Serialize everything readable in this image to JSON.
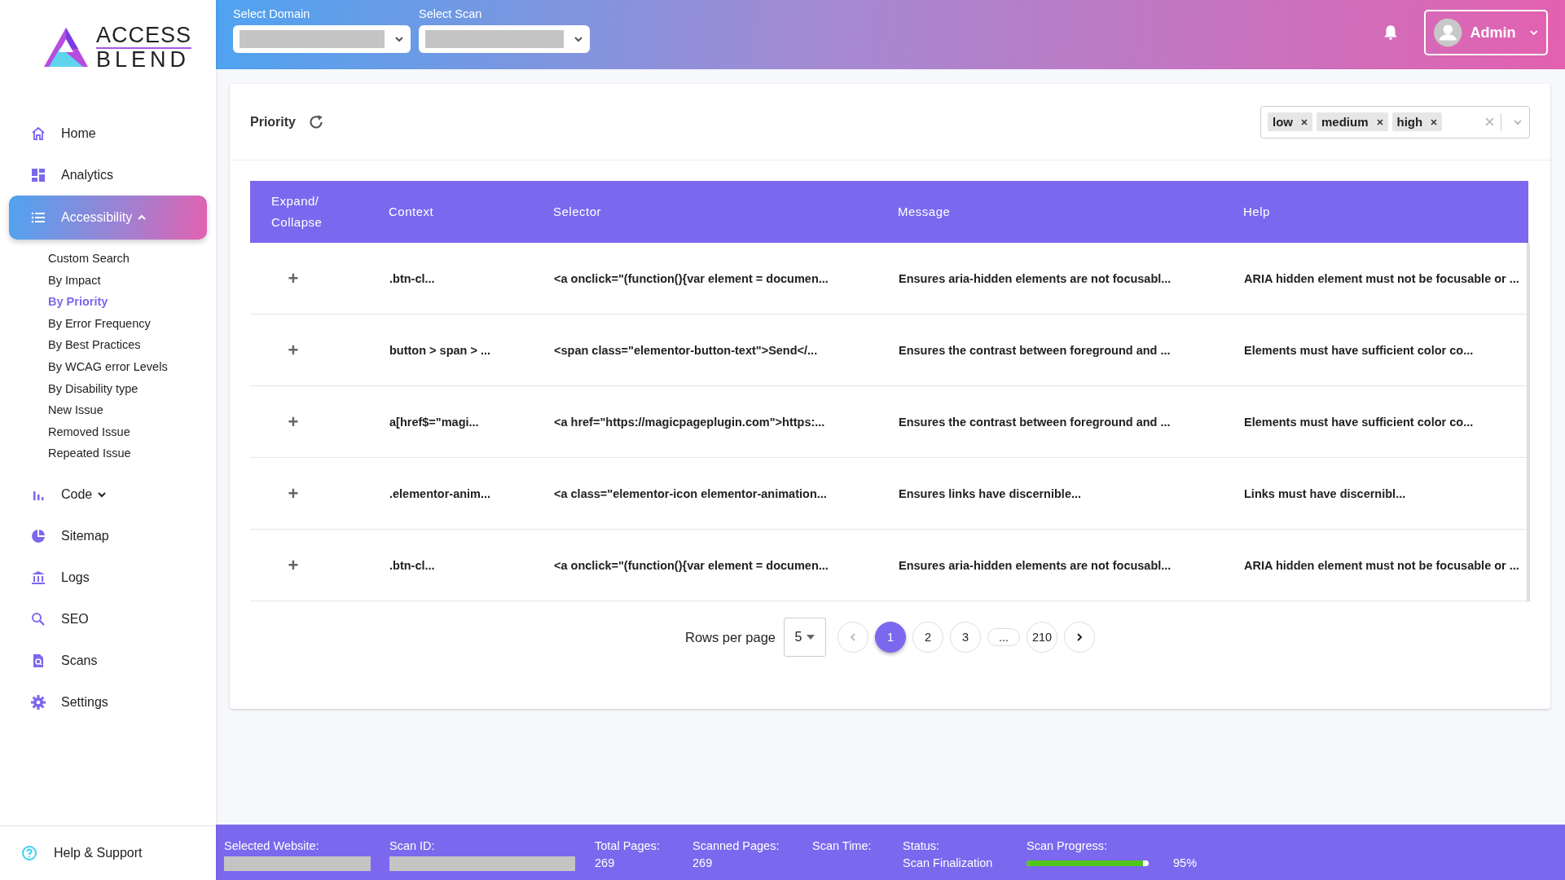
{
  "logo": {
    "line1": "ACCESS",
    "line2": "BLEND"
  },
  "nav": [
    {
      "label": "Home",
      "kind": "home",
      "selected": false
    },
    {
      "label": "Analytics",
      "kind": "dashboard",
      "selected": false
    },
    {
      "label": "Accessibility",
      "kind": "list",
      "selected": true,
      "expanded": true,
      "children": [
        {
          "label": "Custom Search",
          "selected": false
        },
        {
          "label": "By Impact",
          "selected": false
        },
        {
          "label": "By Priority",
          "selected": true
        },
        {
          "label": "By Error Frequency",
          "selected": false
        },
        {
          "label": "By Best Practices",
          "selected": false
        },
        {
          "label": "By WCAG error Levels",
          "selected": false
        },
        {
          "label": "By Disability type",
          "selected": false
        },
        {
          "label": "New Issue",
          "selected": false
        },
        {
          "label": "Removed Issue",
          "selected": false
        },
        {
          "label": "Repeated Issue",
          "selected": false
        }
      ]
    },
    {
      "label": "Code",
      "kind": "bars",
      "selected": false,
      "expanded": false
    },
    {
      "label": "Sitemap",
      "kind": "pie",
      "selected": false
    },
    {
      "label": "Logs",
      "kind": "bank",
      "selected": false
    },
    {
      "label": "SEO",
      "kind": "search",
      "selected": false
    },
    {
      "label": "Scans",
      "kind": "scan",
      "selected": false
    },
    {
      "label": "Settings",
      "kind": "gear",
      "selected": false
    }
  ],
  "help": {
    "label": "Help & Support"
  },
  "header": {
    "selects": [
      {
        "label": "Select Domain"
      },
      {
        "label": "Select Scan"
      }
    ],
    "user": {
      "name": "Admin"
    }
  },
  "filter": {
    "title": "Priority",
    "tags": [
      "low",
      "medium",
      "high"
    ]
  },
  "table": {
    "columns": [
      "Expand/ Collapse",
      "Context",
      "Selector",
      "Message",
      "Help"
    ],
    "rows": [
      {
        "expand": "+",
        "context": ".btn-cl...",
        "selector": "<a onclick=\"(function(){var element = documen...",
        "message": "Ensures aria-hidden elements are not focusabl...",
        "help": "ARIA hidden element must not be focusable or ..."
      },
      {
        "expand": "+",
        "context": "button > span > ...",
        "selector": "<span class=\"elementor-button-text\">Send</...",
        "message": "Ensures the contrast between foreground and ...",
        "help": "Elements must have sufficient color co..."
      },
      {
        "expand": "+",
        "context": "a[href$=\"magi...",
        "selector": "<a href=\"https://magicpageplugin.com\">https:...",
        "message": "Ensures the contrast between foreground and ...",
        "help": "Elements must have sufficient color co..."
      },
      {
        "expand": "+",
        "context": ".elementor-anim...",
        "selector": "<a class=\"elementor-icon elementor-animation...",
        "message": "Ensures links have discernible...",
        "help": "Links must have discernibl..."
      },
      {
        "expand": "+",
        "context": ".btn-cl...",
        "selector": "<a onclick=\"(function(){var element = documen...",
        "message": "Ensures aria-hidden elements are not focusabl...",
        "help": "ARIA hidden element must not be focusable or ..."
      }
    ]
  },
  "pagination": {
    "rows_label": "Rows per page",
    "rows_value": "5",
    "pages": [
      {
        "label": "1",
        "selected": true
      },
      {
        "label": "2",
        "selected": false
      },
      {
        "label": "3",
        "selected": false
      },
      {
        "label": "...",
        "selected": false
      },
      {
        "label": "210",
        "selected": false
      }
    ]
  },
  "status_bar": [
    {
      "label": "Selected Website:",
      "kind": "masked"
    },
    {
      "label": "Scan ID:",
      "kind": "masked"
    },
    {
      "label": "Total Pages:",
      "kind": "text",
      "value": "269"
    },
    {
      "label": "Scanned Pages:",
      "kind": "text",
      "value": "269"
    },
    {
      "label": "Scan Time:",
      "kind": "text"
    },
    {
      "label": "Status:",
      "kind": "text",
      "value": "Scan Finalization"
    },
    {
      "label": "Scan Progress:",
      "kind": "progress",
      "level": 0.95,
      "value": "95%"
    }
  ]
}
